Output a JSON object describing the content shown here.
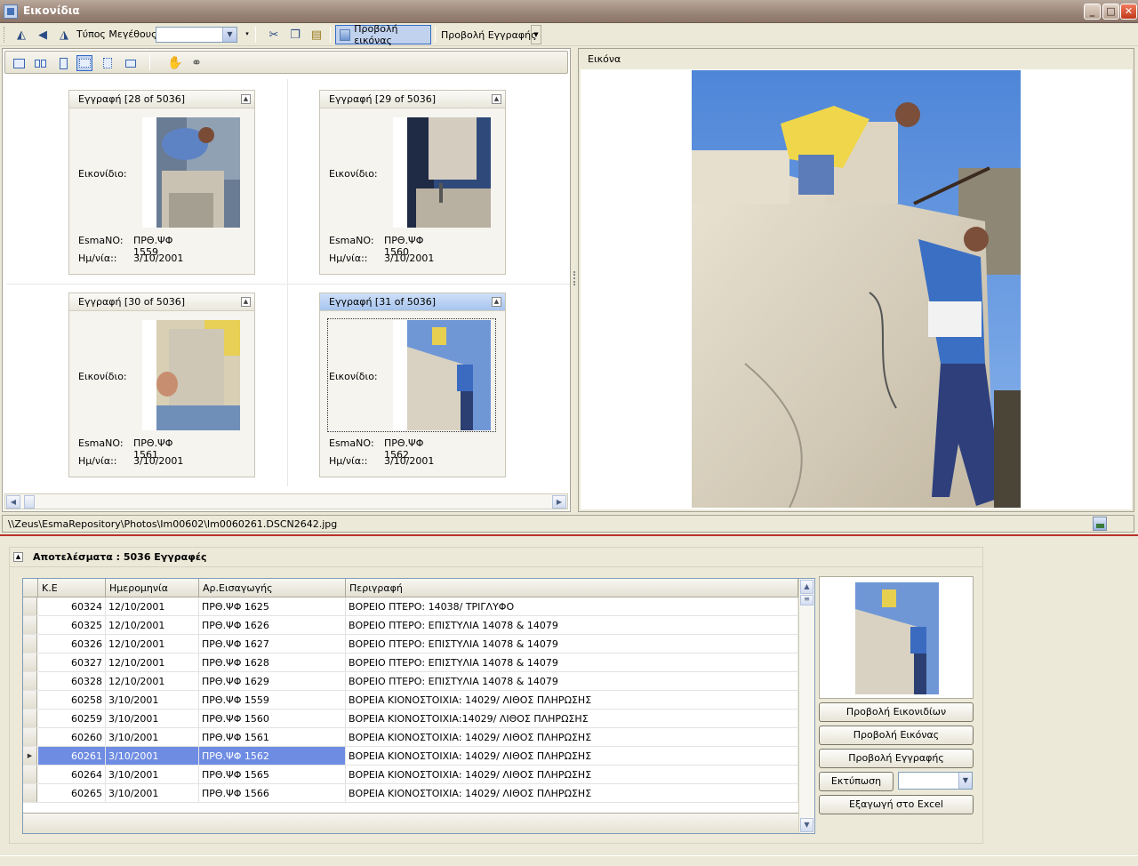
{
  "window": {
    "title": "Εικονίδια"
  },
  "toolbar": {
    "size_type_label": "Τύπος Μεγέθους:",
    "size_type_value": "",
    "view_image_label": "Προβολή εικόνας",
    "view_record_label": "Προβολή Εγγραφής"
  },
  "cards": [
    {
      "header": "Εγγραφή [28 of 5036]",
      "image_label": "Εικονίδιο:",
      "esma_label": "EsmaNO:",
      "esma_value": "ΠΡΘ.ΨΦ 1559",
      "date_label": "Ημ/νία::",
      "date_value": "3/10/2001"
    },
    {
      "header": "Εγγραφή [29 of 5036]",
      "image_label": "Εικονίδιο:",
      "esma_label": "EsmaNO:",
      "esma_value": "ΠΡΘ.ΨΦ 1560",
      "date_label": "Ημ/νία::",
      "date_value": "3/10/2001"
    },
    {
      "header": "Εγγραφή [30 of 5036]",
      "image_label": "Εικονίδιο:",
      "esma_label": "EsmaNO:",
      "esma_value": "ΠΡΘ.ΨΦ 1561",
      "date_label": "Ημ/νία::",
      "date_value": "3/10/2001"
    },
    {
      "header": "Εγγραφή [31 of 5036]",
      "image_label": "Εικονίδιο:",
      "esma_label": "EsmaNO:",
      "esma_value": "ΠΡΘ.ΨΦ 1562",
      "date_label": "Ημ/νία::",
      "date_value": "3/10/2001"
    }
  ],
  "image_panel": {
    "caption": "Εικόνα"
  },
  "path": "\\\\Zeus\\EsmaRepository\\Photos\\Im00602\\Im0060261.DSCN2642.jpg",
  "results": {
    "title": "Αποτελέσματα : 5036 Εγγραφές",
    "columns": [
      "Κ.Ε",
      "Ημερομηνία",
      "Αρ.Εισαγωγής",
      "Περιγραφή"
    ],
    "rows": [
      {
        "ke": "60324",
        "date": "12/10/2001",
        "entry": "ΠΡΘ.ΨΦ 1625",
        "desc": "ΒΟΡΕΙΟ ΠΤΕΡΟ: 14038/ ΤΡΙΓΛΥΦΟ"
      },
      {
        "ke": "60325",
        "date": "12/10/2001",
        "entry": "ΠΡΘ.ΨΦ 1626",
        "desc": "ΒΟΡΕΙΟ ΠΤΕΡΟ: ΕΠΙΣΤΥΛΙΑ 14078 & 14079"
      },
      {
        "ke": "60326",
        "date": "12/10/2001",
        "entry": "ΠΡΘ.ΨΦ 1627",
        "desc": "ΒΟΡΕΙΟ ΠΤΕΡΟ: ΕΠΙΣΤΥΛΙΑ 14078 & 14079"
      },
      {
        "ke": "60327",
        "date": "12/10/2001",
        "entry": "ΠΡΘ.ΨΦ 1628",
        "desc": "ΒΟΡΕΙΟ ΠΤΕΡΟ: ΕΠΙΣΤΥΛΙΑ 14078 & 14079"
      },
      {
        "ke": "60328",
        "date": "12/10/2001",
        "entry": "ΠΡΘ.ΨΦ 1629",
        "desc": "ΒΟΡΕΙΟ ΠΤΕΡΟ: ΕΠΙΣΤΥΛΙΑ 14078 & 14079"
      },
      {
        "ke": "60258",
        "date": "3/10/2001",
        "entry": "ΠΡΘ.ΨΦ 1559",
        "desc": "ΒΟΡΕΙΑ ΚΙΟΝΟΣΤΟΙΧΙΑ: 14029/ ΛΙΘΟΣ ΠΛΗΡΩΣΗΣ"
      },
      {
        "ke": "60259",
        "date": "3/10/2001",
        "entry": "ΠΡΘ.ΨΦ 1560",
        "desc": "ΒΟΡΕΙΑ ΚΙΟΝΟΣΤΟΙΧΙΑ:14029/ ΛΙΘΟΣ ΠΛΗΡΩΣΗΣ"
      },
      {
        "ke": "60260",
        "date": "3/10/2001",
        "entry": "ΠΡΘ.ΨΦ 1561",
        "desc": "ΒΟΡΕΙΑ ΚΙΟΝΟΣΤΟΙΧΙΑ: 14029/ ΛΙΘΟΣ ΠΛΗΡΩΣΗΣ"
      },
      {
        "ke": "60261",
        "date": "3/10/2001",
        "entry": "ΠΡΘ.ΨΦ 1562",
        "desc": "ΒΟΡΕΙΑ ΚΙΟΝΟΣΤΟΙΧΙΑ: 14029/ ΛΙΘΟΣ ΠΛΗΡΩΣΗΣ"
      },
      {
        "ke": "60264",
        "date": "3/10/2001",
        "entry": "ΠΡΘ.ΨΦ 1565",
        "desc": "ΒΟΡΕΙΑ ΚΙΟΝΟΣΤΟΙΧΙΑ: 14029/ ΛΙΘΟΣ ΠΛΗΡΩΣΗΣ"
      },
      {
        "ke": "60265",
        "date": "3/10/2001",
        "entry": "ΠΡΘ.ΨΦ 1566",
        "desc": "ΒΟΡΕΙΑ ΚΙΟΝΟΣΤΟΙΧΙΑ: 14029/ ΛΙΘΟΣ ΠΛΗΡΩΣΗΣ"
      }
    ],
    "selected_row_ke": "60261"
  },
  "side_buttons": {
    "view_thumbnails": "Προβολή Εικονιδίων",
    "view_image": "Προβολή Εικόνας",
    "view_record": "Προβολή Εγγραφής",
    "print": "Εκτύπωση",
    "export_excel": "Εξαγωγή στο Excel"
  }
}
